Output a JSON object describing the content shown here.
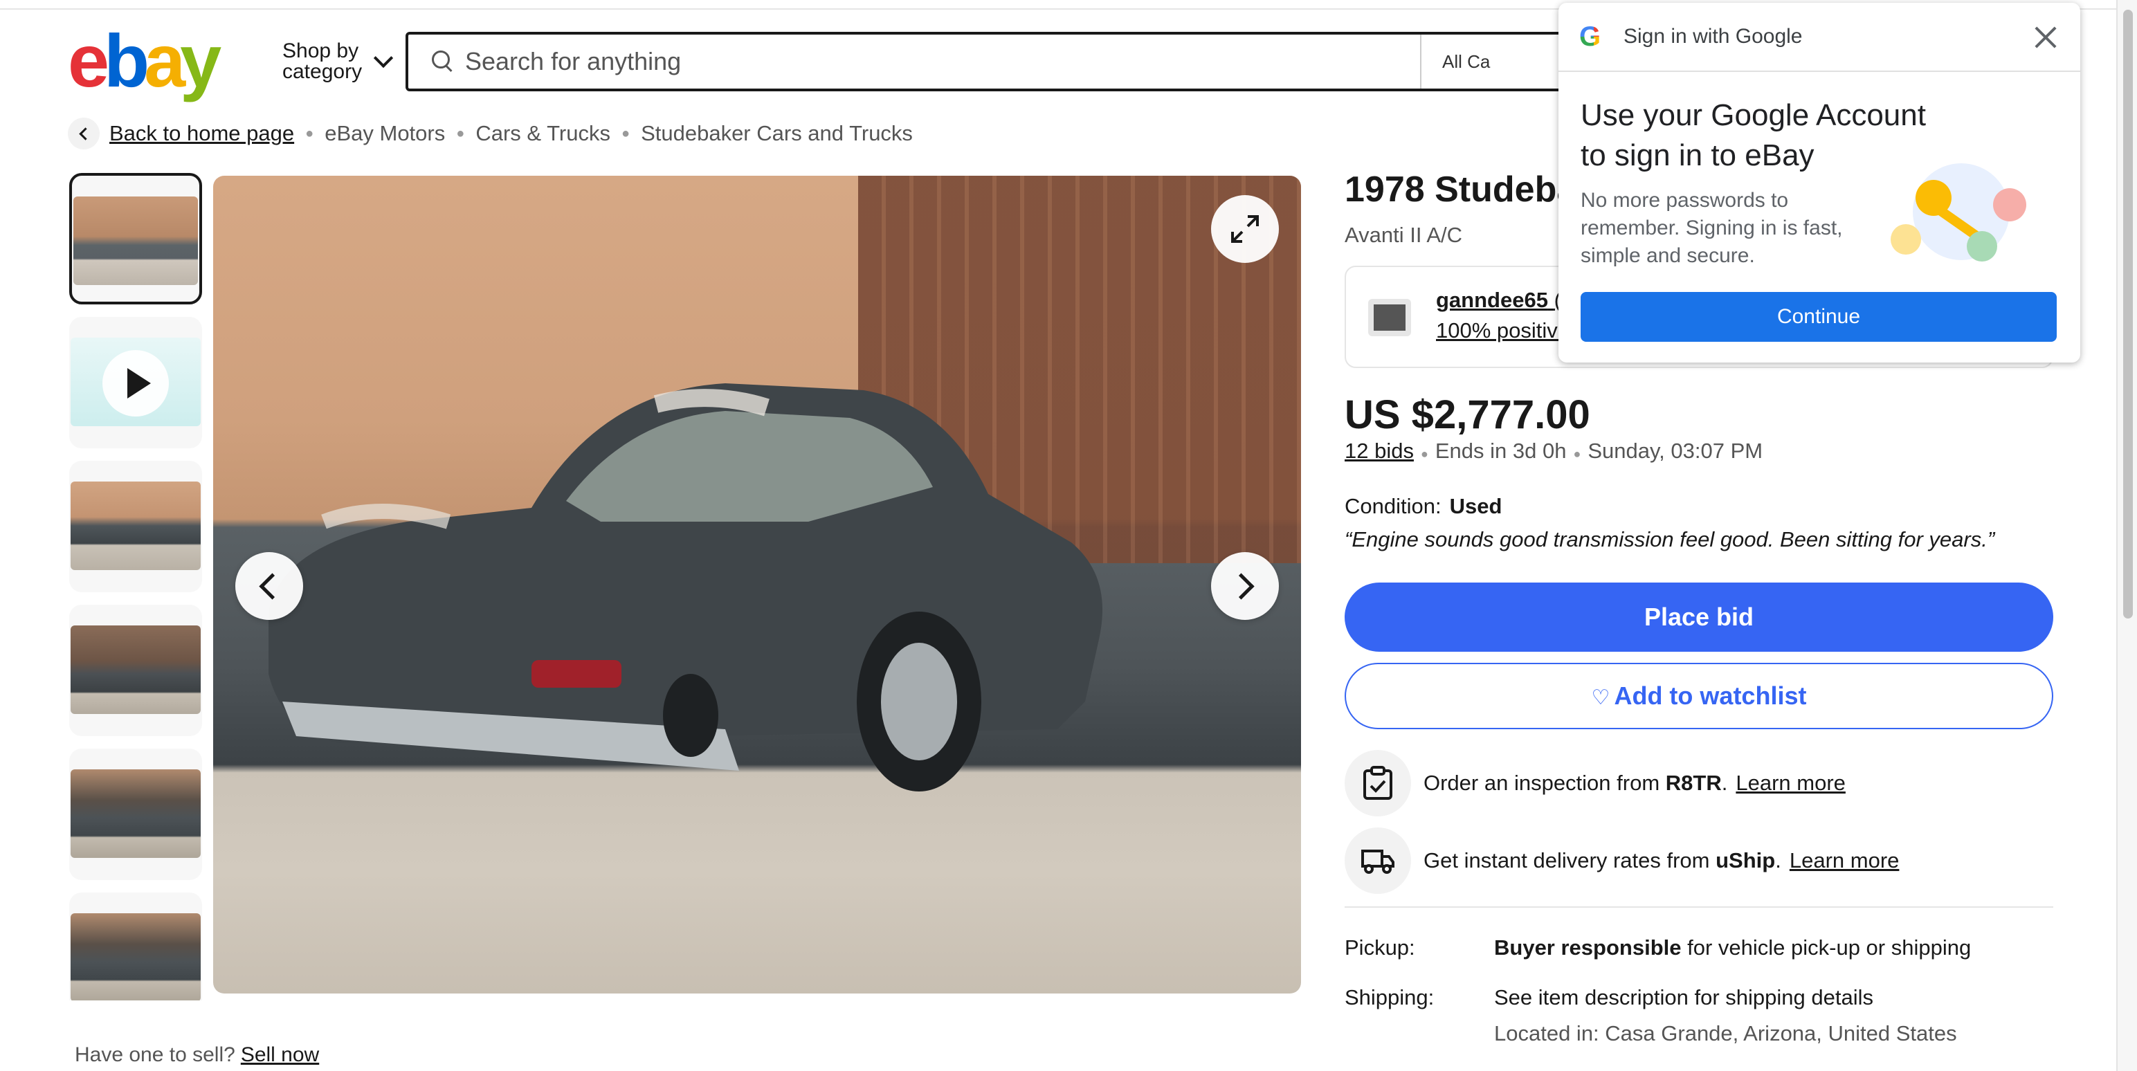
{
  "header": {
    "logo_letters": [
      "e",
      "b",
      "a",
      "y"
    ],
    "shop_by_label": "Shop by category",
    "search_placeholder": "Search for anything",
    "category_select": "All Ca"
  },
  "breadcrumb": {
    "back_label": "Back to home page",
    "items": [
      "eBay Motors",
      "Cars & Trucks",
      "Studebaker Cars and Trucks"
    ]
  },
  "listing": {
    "title": "1978 Studebak",
    "subtitle": "Avanti II A/C",
    "seller_name": "ganndee65",
    "seller_name_suffix": "(",
    "seller_feedback": "100% positive",
    "price": "US $2,777.00",
    "bids": "12 bids",
    "ends_in": "Ends in 3d 0h",
    "end_time": "Sunday, 03:07 PM",
    "condition_label": "Condition:",
    "condition_value": "Used",
    "seller_notes": "“Engine sounds good transmission feel good. Been sitting for years.”",
    "place_bid_label": "Place bid",
    "watchlist_label": "Add to watchlist",
    "inspection": {
      "prefix": "Order an inspection from",
      "provider": "R8TR",
      "link": "Learn more"
    },
    "delivery": {
      "prefix": "Get instant delivery rates from",
      "provider": "uShip",
      "link": "Learn more"
    },
    "pickup_label": "Pickup:",
    "pickup_bold": "Buyer responsible",
    "pickup_rest": "for vehicle pick-up or shipping",
    "shipping_label": "Shipping:",
    "shipping_value": "See item description for shipping details",
    "location": "Located in: Casa Grande, Arizona, United States"
  },
  "gallery": {
    "thumbnail_count": 6,
    "selected_index": 0,
    "video_thumbnail_index": 1
  },
  "sell_prompt": {
    "text": "Have one to sell?",
    "link": "Sell now"
  },
  "google_popup": {
    "header": "Sign in with Google",
    "heading": "Use your Google Account to sign in to eBay",
    "description": "No more passwords to remember. Signing in is fast, simple and secure.",
    "continue_label": "Continue"
  },
  "colors": {
    "primary_blue": "#3665f3",
    "google_blue": "#1a73e8",
    "text": "#191919",
    "muted": "#555555"
  }
}
